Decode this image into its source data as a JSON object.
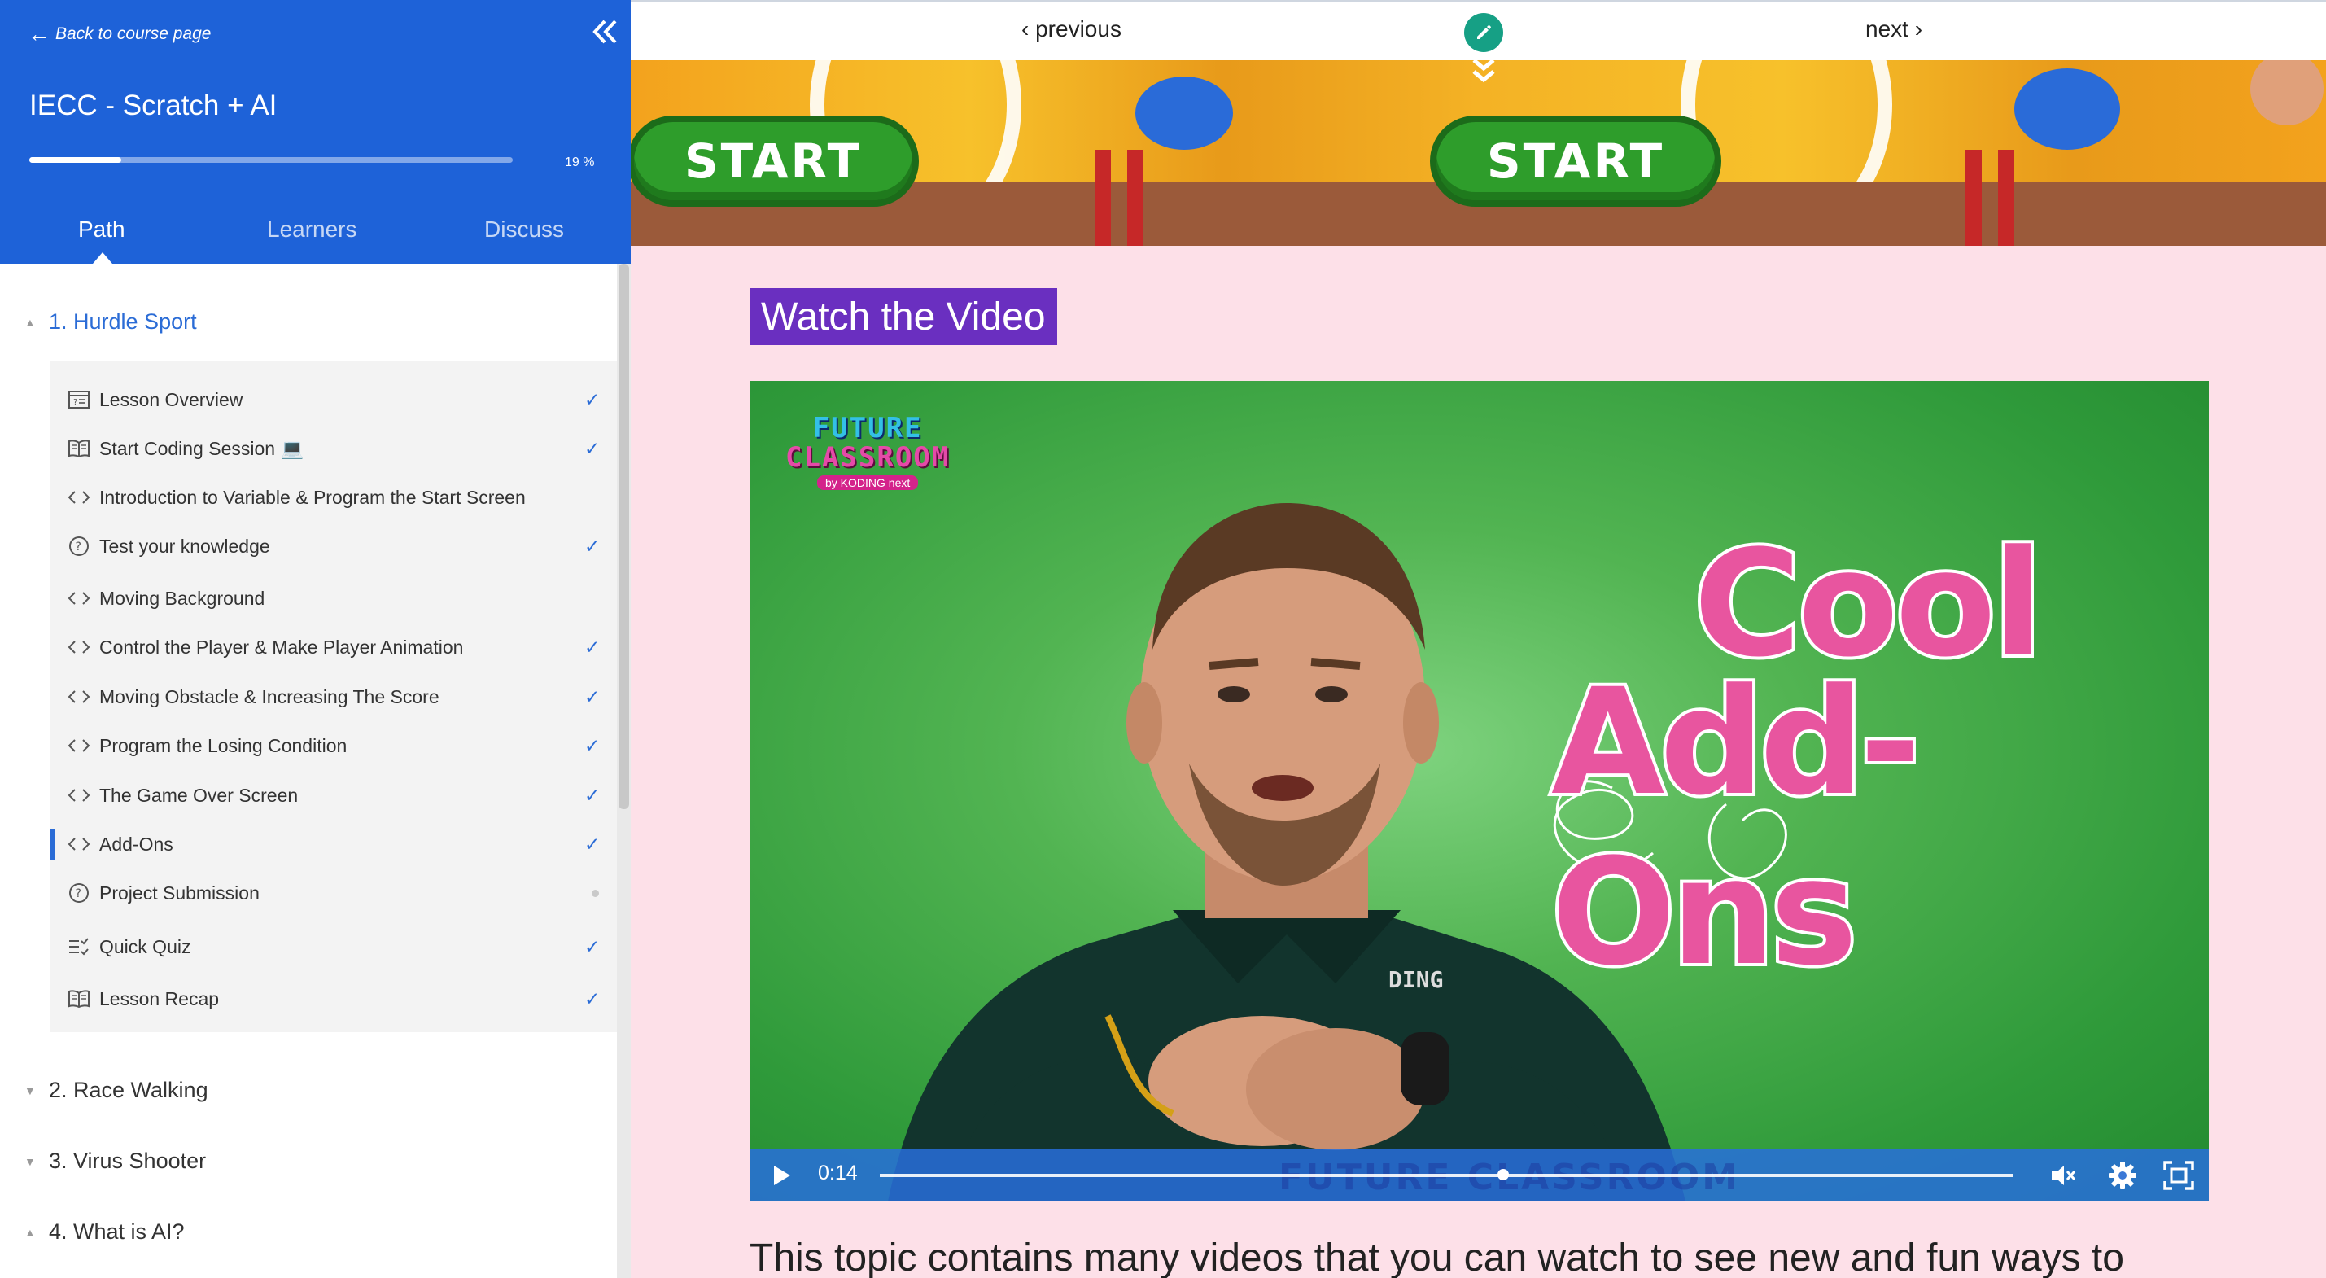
{
  "sidebar": {
    "back_label": "Back to course page",
    "course_title": "IECC - Scratch + AI",
    "progress": {
      "percent_label": "19 %",
      "fraction": 0.19
    },
    "tabs": [
      {
        "label": "Path",
        "active": true
      },
      {
        "label": "Learners",
        "active": false
      },
      {
        "label": "Discuss",
        "active": false
      }
    ],
    "sections": [
      {
        "label": "1. Hurdle Sport",
        "expanded": true,
        "lessons": [
          {
            "icon": "overview-icon",
            "label": "Lesson Overview",
            "status": "done"
          },
          {
            "icon": "book-icon",
            "label": "Start Coding Session 💻",
            "status": "done"
          },
          {
            "icon": "code-icon",
            "label": "Introduction to Variable & Program the Start Screen",
            "status": "none"
          },
          {
            "icon": "question-icon",
            "label": "Test your knowledge",
            "status": "done"
          },
          {
            "icon": "code-icon",
            "label": "Moving Background",
            "status": "none"
          },
          {
            "icon": "code-icon",
            "label": "Control the Player & Make Player Animation",
            "status": "done"
          },
          {
            "icon": "code-icon",
            "label": "Moving Obstacle & Increasing The Score",
            "status": "done"
          },
          {
            "icon": "code-icon",
            "label": "Program the Losing Condition",
            "status": "done"
          },
          {
            "icon": "code-icon",
            "label": "The Game Over Screen",
            "status": "done"
          },
          {
            "icon": "code-icon",
            "label": "Add-Ons",
            "status": "done",
            "current": true
          },
          {
            "icon": "question-icon",
            "label": "Project Submission",
            "status": "pending"
          },
          {
            "icon": "quiz-icon",
            "label": "Quick Quiz",
            "status": "done"
          },
          {
            "icon": "book-icon",
            "label": "Lesson Recap",
            "status": "done"
          }
        ]
      },
      {
        "label": "2. Race Walking",
        "expanded": false
      },
      {
        "label": "3. Virus Shooter",
        "expanded": false
      },
      {
        "label": "4. What is AI?",
        "expanded": false
      }
    ]
  },
  "topnav": {
    "previous_label": "previous",
    "next_label": "next"
  },
  "banner": {
    "start_label": "START"
  },
  "content": {
    "section_title": "Watch the Video",
    "video": {
      "logo_line1": "FUTURE",
      "logo_line2": "CLASSROOM",
      "logo_line3": "by KODING next",
      "title_line1": "Cool",
      "title_line2": "Add-Ons",
      "shirt_text": "DING",
      "time": "0:14",
      "progress_fraction": 0.55,
      "watermark": "FUTURE CLASSROOM"
    },
    "body_text": "This topic contains many videos that you can watch to see new and fun ways to"
  },
  "colors": {
    "sidebar_header": "#1e62d8",
    "accent_blue": "#2b6cd6",
    "section_title_bg": "#6a2fc0",
    "content_bg": "#fde0e8",
    "edit_button": "#16a085",
    "title_pink": "#e8559f"
  }
}
